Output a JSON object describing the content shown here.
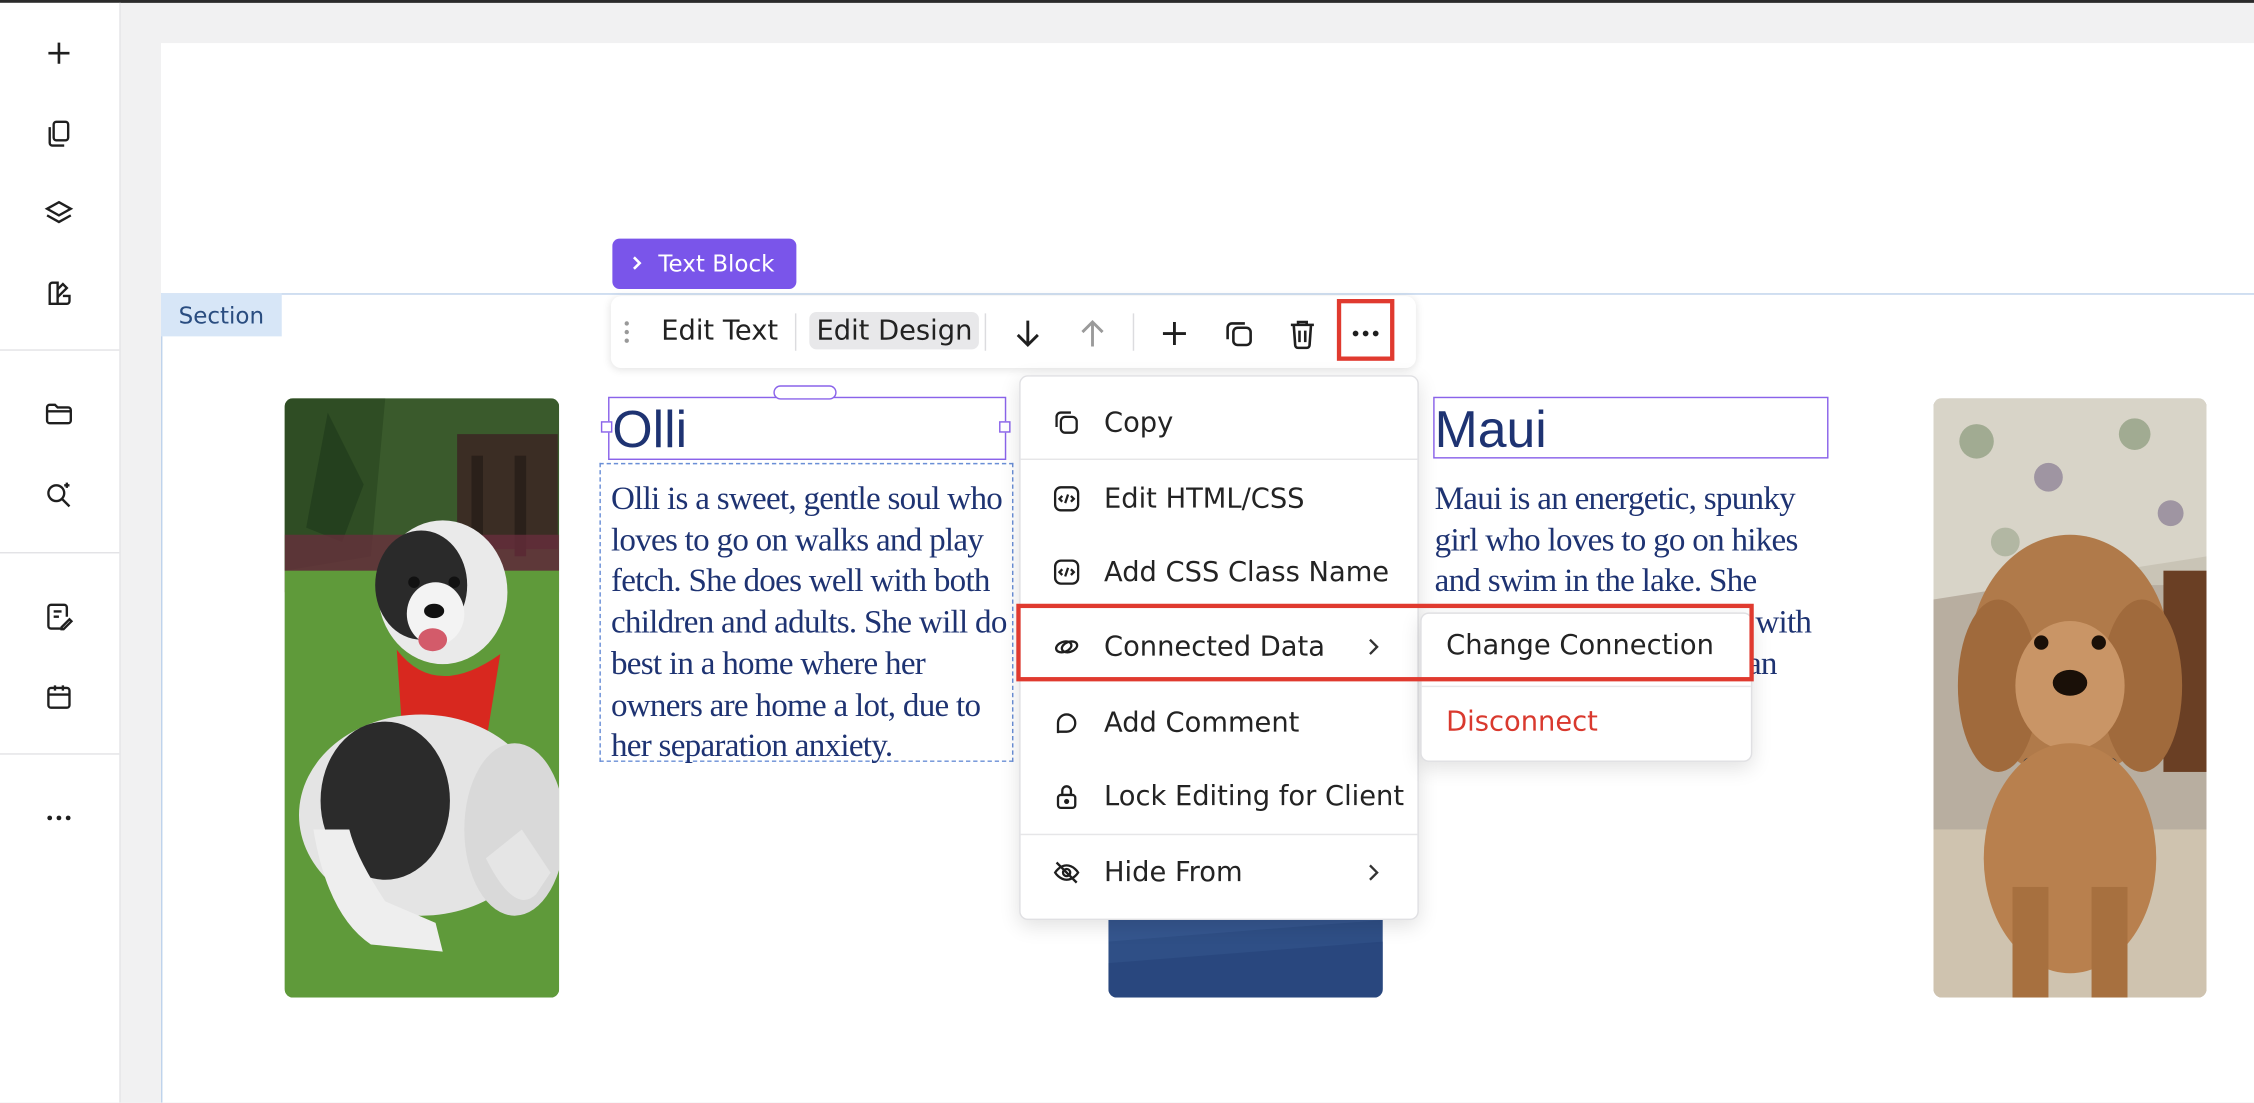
{
  "sidebar": {
    "items": [
      {
        "icon": "plus-icon"
      },
      {
        "icon": "pages-icon"
      },
      {
        "icon": "layers-icon"
      },
      {
        "icon": "design-icon"
      },
      {
        "icon": "folder-icon"
      },
      {
        "icon": "search-sparkle-icon"
      },
      {
        "icon": "forms-icon"
      },
      {
        "icon": "calendar-icon"
      },
      {
        "icon": "more-icon"
      }
    ]
  },
  "section_tag": "Section",
  "text_block_badge": "Text Block",
  "toolbar": {
    "edit_text": "Edit Text",
    "edit_design": "Edit Design"
  },
  "pets": [
    {
      "name": "Olli",
      "description": "Olli is a sweet, gentle soul who loves to go on walks and play fetch. She does well with both children and adults. She will do best in a home where her owners are home a lot, due to her separation anxiety."
    },
    {
      "name": "Maui",
      "description_visible": [
        "Maui is an energetic, spunky",
        "girl who loves to go on hikes",
        "and swim in the lake. She",
        "with",
        "an"
      ]
    }
  ],
  "menu": {
    "items": [
      {
        "label": "Copy",
        "icon": "copy-icon"
      },
      {
        "label": "Edit HTML/CSS",
        "icon": "code-icon"
      },
      {
        "label": "Add CSS Class Name",
        "icon": "code-icon"
      },
      {
        "label": "Connected Data",
        "icon": "link-icon",
        "has_submenu": true
      },
      {
        "label": "Add Comment",
        "icon": "comment-icon"
      },
      {
        "label": "Lock Editing for Client",
        "icon": "lock-icon"
      },
      {
        "label": "Hide From",
        "icon": "eye-off-icon",
        "has_submenu": true
      }
    ]
  },
  "submenu": {
    "change_connection": "Change Connection",
    "disconnect": "Disconnect"
  },
  "colors": {
    "accent": "#7a55ea",
    "highlight": "#e03a2f",
    "text_navy": "#1e3372",
    "danger": "#d9392e",
    "section_tag_bg": "#d7e6f7"
  }
}
